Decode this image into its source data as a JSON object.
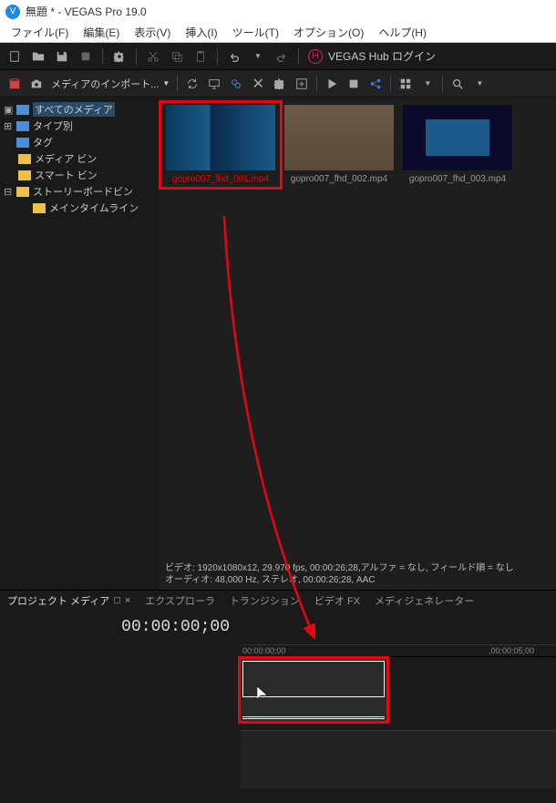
{
  "titlebar": {
    "title": "無題 * - VEGAS Pro 19.0"
  },
  "menubar": {
    "file": "ファイル(F)",
    "edit": "編集(E)",
    "view": "表示(V)",
    "insert": "挿入(I)",
    "tools": "ツール(T)",
    "options": "オプション(O)",
    "help": "ヘルプ(H)"
  },
  "toolbar": {
    "hub_label": "VEGAS Hub ログイン"
  },
  "toolbar2": {
    "import_label": "メディアのインポート..."
  },
  "sidebar": {
    "all_media": "すべてのメディア",
    "by_type": "タイプ別",
    "tags": "タグ",
    "media_bin": "メディア ビン",
    "smart_bin": "スマート ビン",
    "storyboard_bin": "ストーリーボードビン",
    "main_timeline": "メインタイムライン"
  },
  "media": {
    "items": [
      {
        "name": "gopro007_fhd_001.mp4"
      },
      {
        "name": "gopro007_fhd_002.mp4"
      },
      {
        "name": "gopro007_fhd_003.mp4"
      }
    ]
  },
  "infobar": {
    "line1": "ビデオ: 1920x1080x12, 29.970 fps, 00:00:26;28,アルファ = なし, フィールド順 = なし",
    "line2": "オーディオ: 48,000 Hz, ステレオ, 00:00:26;28, AAC"
  },
  "tabs": {
    "project_media": "プロジェクト メディア",
    "explorer": "エクスプローラ",
    "transitions": "トランジション",
    "video_fx": "ビデオ FX",
    "media_generators": "メディジェネレーター"
  },
  "timeline": {
    "timecode": "00:00:00;00",
    "ruler": {
      "t0": "00:00:00;00",
      "t1": ",00:00:05;00"
    }
  }
}
